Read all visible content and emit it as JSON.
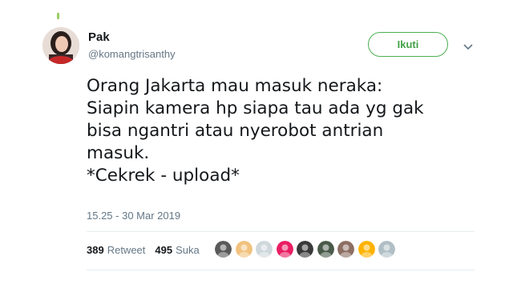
{
  "tweet": {
    "author_name": "Pak",
    "author_handle": "@komangtrisanthy",
    "follow_label": "Ikuti",
    "body_lines": [
      "Orang Jakarta mau masuk neraka:",
      "Siapin kamera hp siapa tau ada yg gak",
      "bisa ngantri atau nyerobot antrian",
      "masuk.",
      "*Cekrek - upload*"
    ],
    "timestamp": "15.25 - 30 Mar 2019",
    "retweet_count": "389",
    "retweet_label": "Retweet",
    "like_count": "495",
    "like_label": "Suka"
  },
  "likers": [
    {
      "icon": "liker-avatar",
      "color": "#5a5a5a"
    },
    {
      "icon": "liker-avatar",
      "color": "#f1c27d"
    },
    {
      "icon": "liker-avatar",
      "color": "#cfd8dc"
    },
    {
      "icon": "liker-avatar",
      "color": "#e91e63"
    },
    {
      "icon": "liker-avatar",
      "color": "#3a3a3a"
    },
    {
      "icon": "liker-avatar",
      "color": "#4a5a4a"
    },
    {
      "icon": "liker-avatar",
      "color": "#8d6e63"
    },
    {
      "icon": "liker-avatar",
      "color": "#ffb300"
    },
    {
      "icon": "liker-avatar",
      "color": "#b0bec5"
    }
  ],
  "colors": {
    "follow_accent": "#4caf50",
    "secondary_text": "#657786",
    "primary_text": "#14171a"
  }
}
